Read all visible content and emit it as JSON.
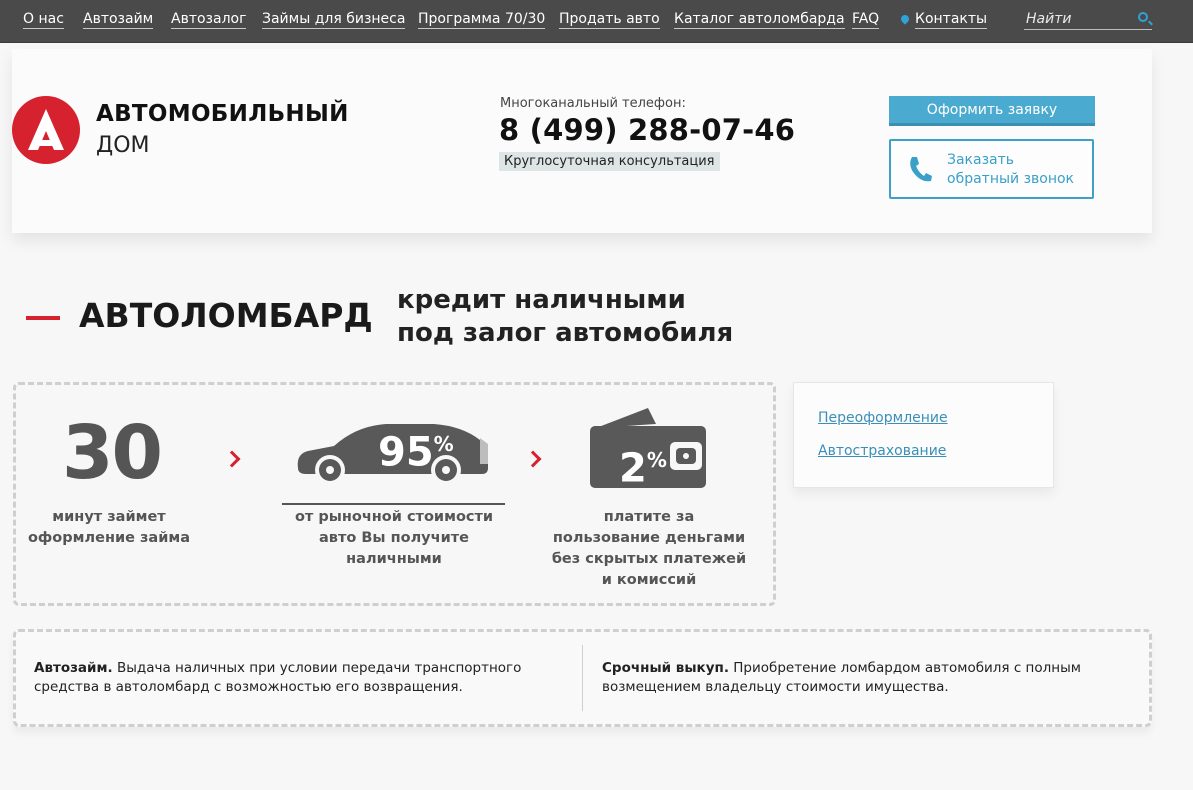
{
  "nav": {
    "items": [
      "О нас",
      "Автозайм",
      "Автозалог",
      "Займы для бизнеса",
      "Программа 70/30",
      "Продать авто",
      "Каталог автоломбарда",
      "FAQ",
      "Контакты"
    ],
    "search_placeholder": "Найти"
  },
  "header": {
    "brand_line1": "АВТОМОБИЛЬНЫЙ",
    "brand_line2": "ДОМ",
    "phone_label": "Многоканальный телефон:",
    "phone": "8 (499) 288-07-46",
    "consult": "Круглосуточная консультация",
    "order_button": "Оформить заявку",
    "callback_line1": "Заказать",
    "callback_line2": "обратный звонок"
  },
  "headline": {
    "main": "АВТОЛОМБАРД",
    "sub_line1": "кредит наличными",
    "sub_line2": "под залог автомобиля"
  },
  "features": [
    {
      "value": "30",
      "caption": [
        "минут займет",
        "оформление займа"
      ]
    },
    {
      "value": "95",
      "unit": "%",
      "caption": [
        "от рыночной стоимости",
        "авто Вы получите",
        "наличными"
      ]
    },
    {
      "value": "2",
      "unit": "%",
      "caption": [
        "платите за",
        "пользование деньгами",
        "без скрытых платежей",
        "и комиссий"
      ]
    }
  ],
  "links": [
    "Переоформление",
    "Автострахование"
  ],
  "bottom": {
    "left_title": "Автозайм.",
    "left_text_line1": " Выдача наличных при условии передачи транспортного",
    "left_text_line2": "средства в автоломбард с возможностью его возвращения.",
    "right_title": "Срочный выкуп.",
    "right_text_line1": " Приобретение ломбардом автомобиля с полным",
    "right_text_line2": "возмещением владельцу стоимости имущества."
  },
  "colors": {
    "accent_red": "#d6212e",
    "accent_blue": "#4baad0",
    "nav_bg": "#4a4a4a"
  }
}
